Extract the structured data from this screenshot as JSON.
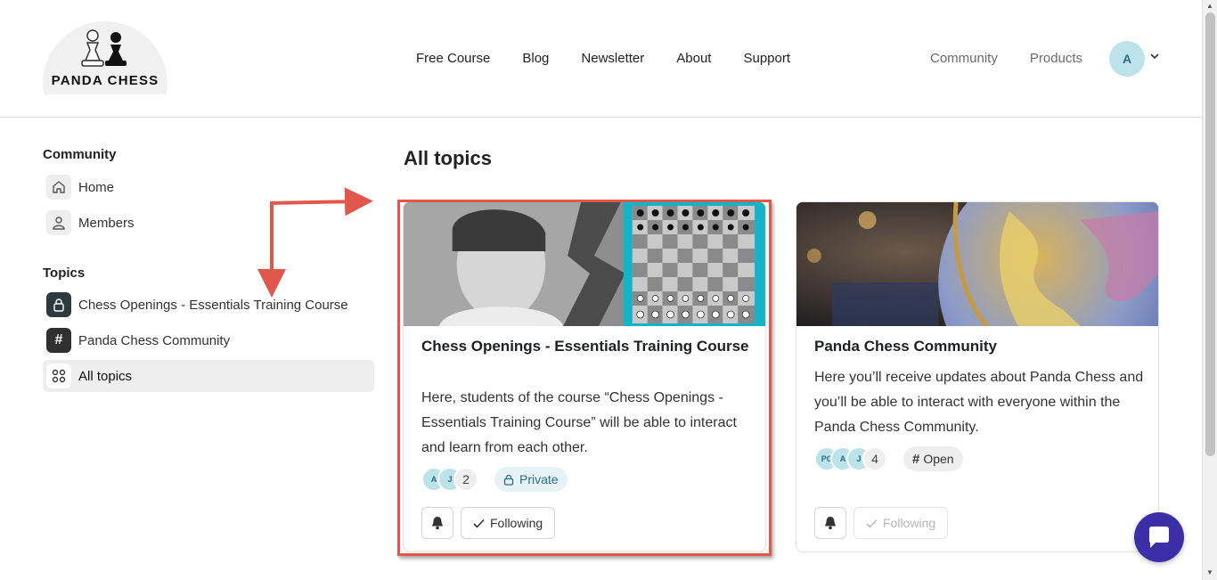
{
  "brand": {
    "name": "PANDA CHESS"
  },
  "nav": {
    "center": [
      "Free Course",
      "Blog",
      "Newsletter",
      "About",
      "Support"
    ],
    "right": [
      "Community",
      "Products"
    ],
    "user_initial": "A"
  },
  "sidebar": {
    "community_heading": "Community",
    "community_items": [
      {
        "label": "Home",
        "icon": "home-icon"
      },
      {
        "label": "Members",
        "icon": "user-icon"
      }
    ],
    "topics_heading": "Topics",
    "topic_items": [
      {
        "label": "Chess Openings - Essentials Training Course",
        "icon": "lock-icon"
      },
      {
        "label": "Panda Chess Community",
        "icon": "hash-icon"
      },
      {
        "label": "All topics",
        "icon": "grid-icon",
        "active": true
      }
    ]
  },
  "main": {
    "title": "All topics",
    "cards": [
      {
        "title": "Chess Openings - Essentials Training Course",
        "description": "Here, students of the course “Chess Openings - Essentials Training Course” will be able to interact and learn from each other.",
        "avatars": [
          "A",
          "J"
        ],
        "member_count": "2",
        "badge": "Private",
        "follow_label": "Following"
      },
      {
        "title": "Panda Chess Community",
        "description": "Here you’ll receive updates about Panda Chess and you’ll be able to interact with everyone within the Panda Chess Community.",
        "avatars": [
          "PC",
          "A",
          "J"
        ],
        "member_count": "4",
        "badge": "Open",
        "follow_label": "Following"
      }
    ]
  },
  "colors": {
    "highlight": "#e2574c",
    "accent": "#3b2fa8",
    "avatar_bg": "#bde3ea"
  }
}
